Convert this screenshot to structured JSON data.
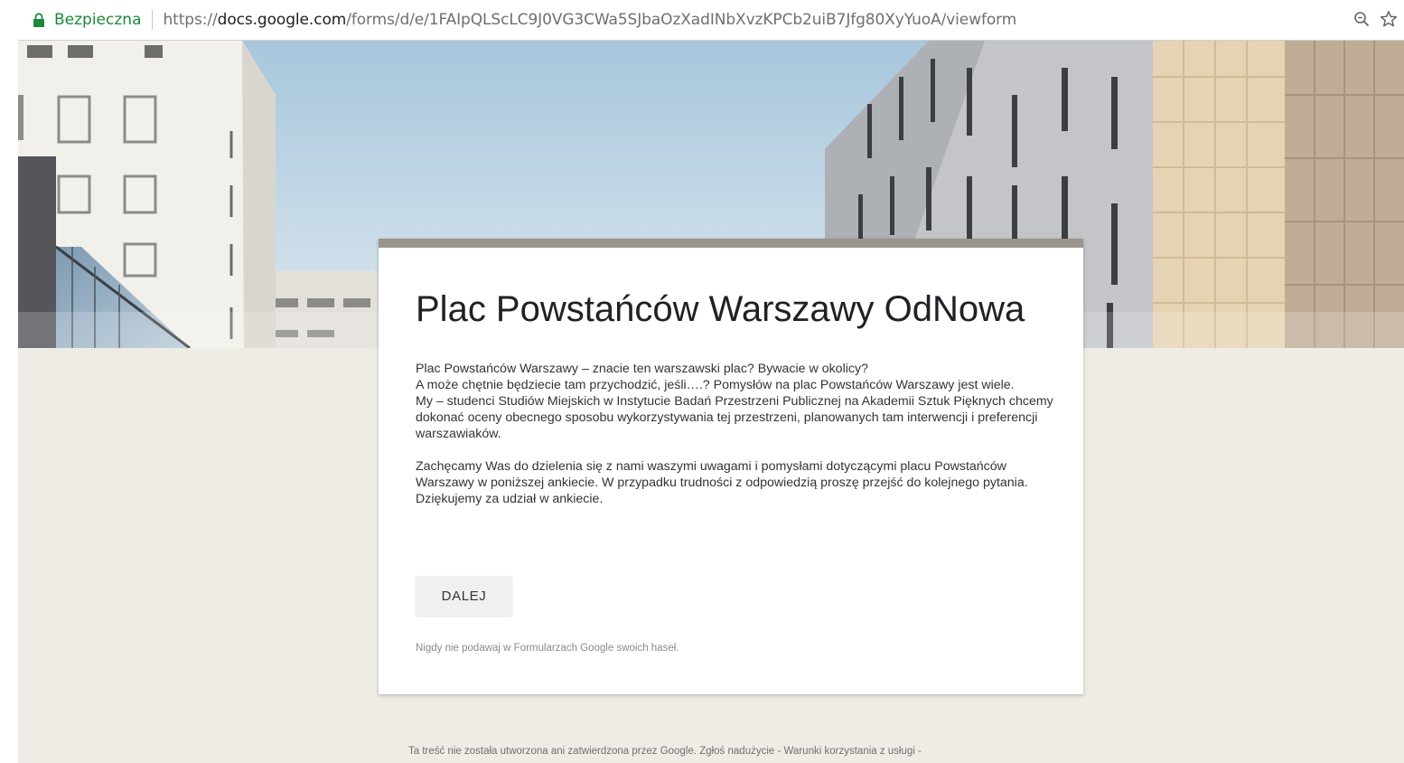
{
  "browser": {
    "secure_label": "Bezpieczna",
    "url_scheme": "https://",
    "url_host": "docs.google.com",
    "url_path": "/forms/d/e/1FAIpQLScLC9J0VG3CWa5SJbaOzXadINbXvzKPCb2uiB7Jfg80XyYuoA/viewform",
    "secure_color": "#1b8a3a",
    "icons": [
      "lock-icon",
      "zoom-icon",
      "bookmark-star-icon"
    ]
  },
  "form": {
    "title": "Plac Powstańców Warszawy OdNowa",
    "accent_color": "#9b958a",
    "background_color": "#efece6",
    "description": {
      "p1_line1": "Plac Powstańców Warszawy – znacie ten warszawski plac? Bywacie w okolicy?",
      "p1_line2": "A może chętnie będziecie tam przychodzić, jeśli….? Pomysłów na plac Powstańców Warszawy jest wiele.",
      "p1_line3": "My – studenci Studiów Miejskich w Instytucie Badań Przestrzeni Publicznej na Akademii Sztuk Pięknych chcemy dokonać oceny obecnego sposobu wykorzystywania tej przestrzeni, planowanych tam interwencji i preferencji warszawiaków.",
      "p2": "Zachęcamy Was do dzielenia się z nami waszymi uwagami i pomysłami dotyczącymi placu Powstańców Warszawy w poniższej ankiecie. W przypadku trudności z odpowiedzią proszę przejść do kolejnego pytania. Dziękujemy za udział w ankiecie."
    },
    "next_button_label": "DALEJ",
    "password_warning": "Nigdy nie podawaj w Formularzach Google swoich haseł."
  },
  "footer": {
    "disclaimer": "Ta treść nie została utworzona ani zatwierdzona przez Google.",
    "report_abuse": "Zgłoś nadużycie",
    "separator": " - ",
    "terms": "Warunki korzystania z usługi",
    "trailing": " -"
  }
}
